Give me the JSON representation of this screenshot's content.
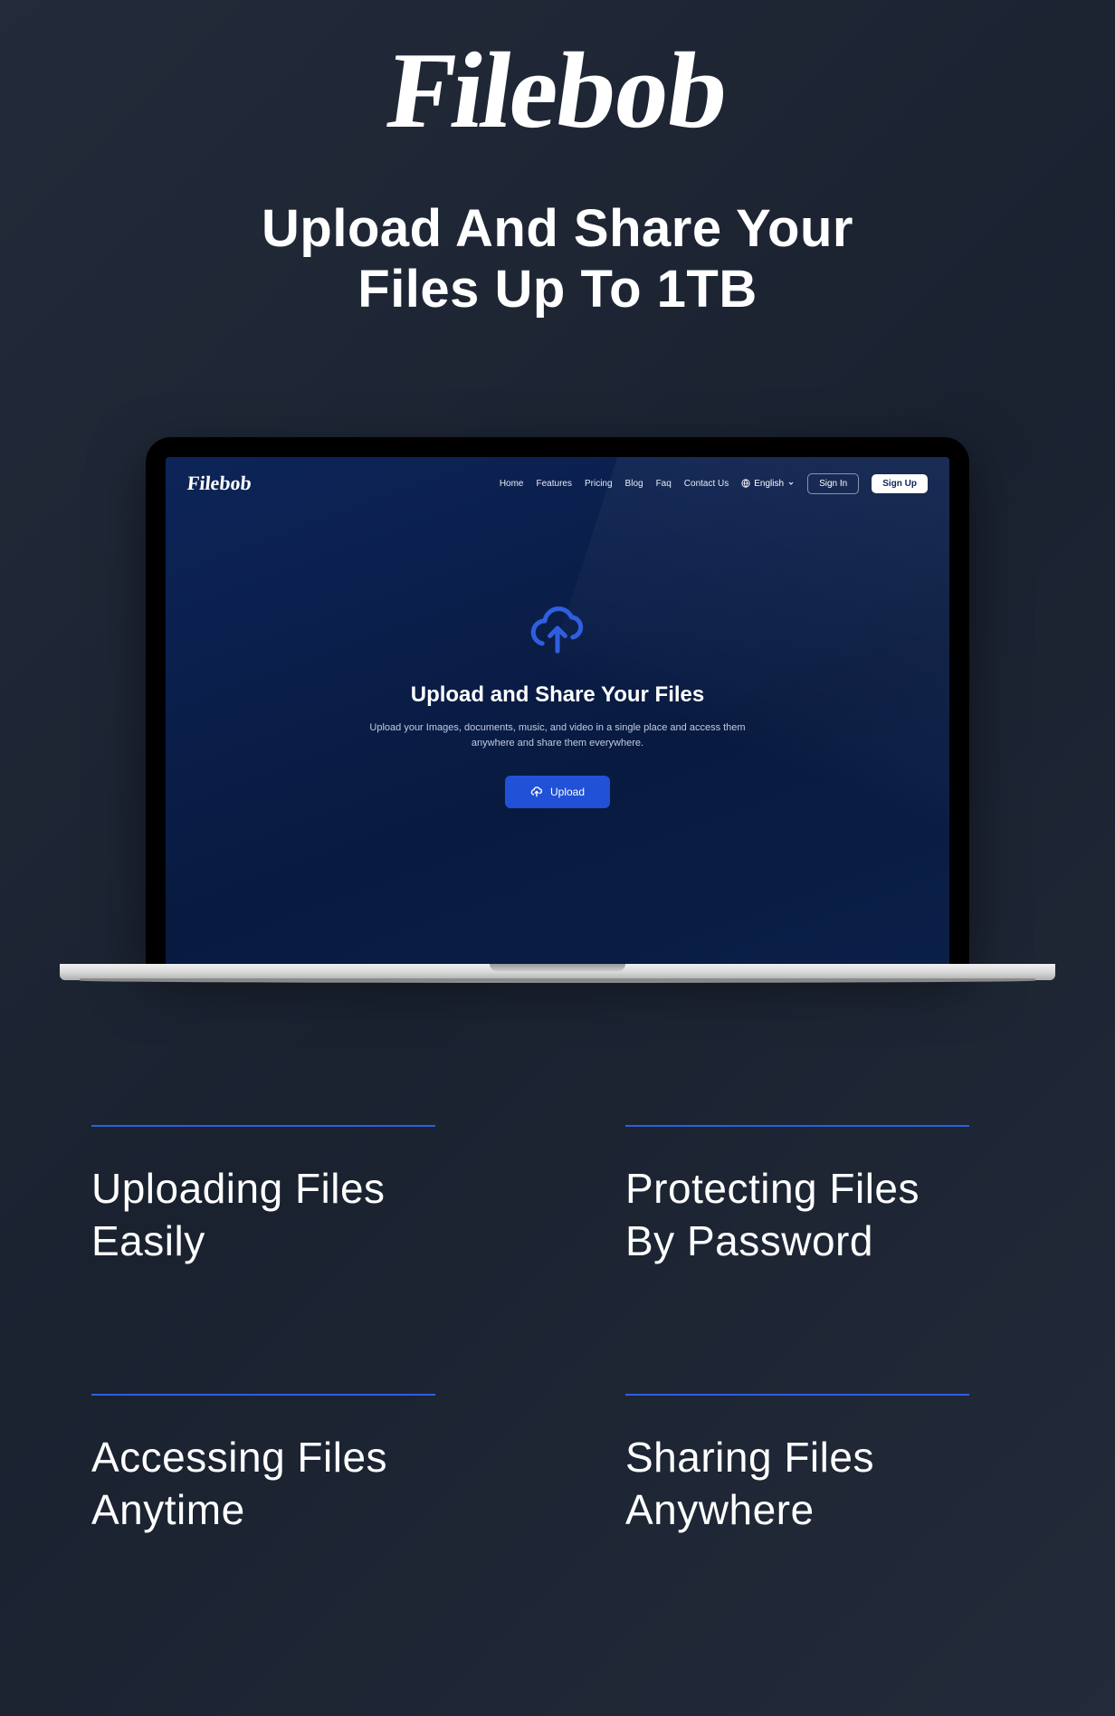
{
  "logo": "Filebob",
  "headline_line1": "Upload And Share Your",
  "headline_line2": "Files Up To 1TB",
  "app": {
    "brand": "Filebob",
    "nav": {
      "home": "Home",
      "features": "Features",
      "pricing": "Pricing",
      "blog": "Blog",
      "faq": "Faq",
      "contact": "Contact Us"
    },
    "language": "English",
    "sign_in": "Sign In",
    "sign_up": "Sign Up",
    "hero": {
      "title": "Upload and Share Your Files",
      "subtitle": "Upload your Images, documents, music, and video in a single place and access them anywhere and share them everywhere.",
      "upload_btn": "Upload"
    }
  },
  "features": [
    {
      "line1": "Uploading Files",
      "line2": "Easily"
    },
    {
      "line1": "Protecting Files",
      "line2": "By Password"
    },
    {
      "line1": "Accessing Files",
      "line2": "Anytime"
    },
    {
      "line1": "Sharing Files",
      "line2": "Anywhere"
    }
  ]
}
